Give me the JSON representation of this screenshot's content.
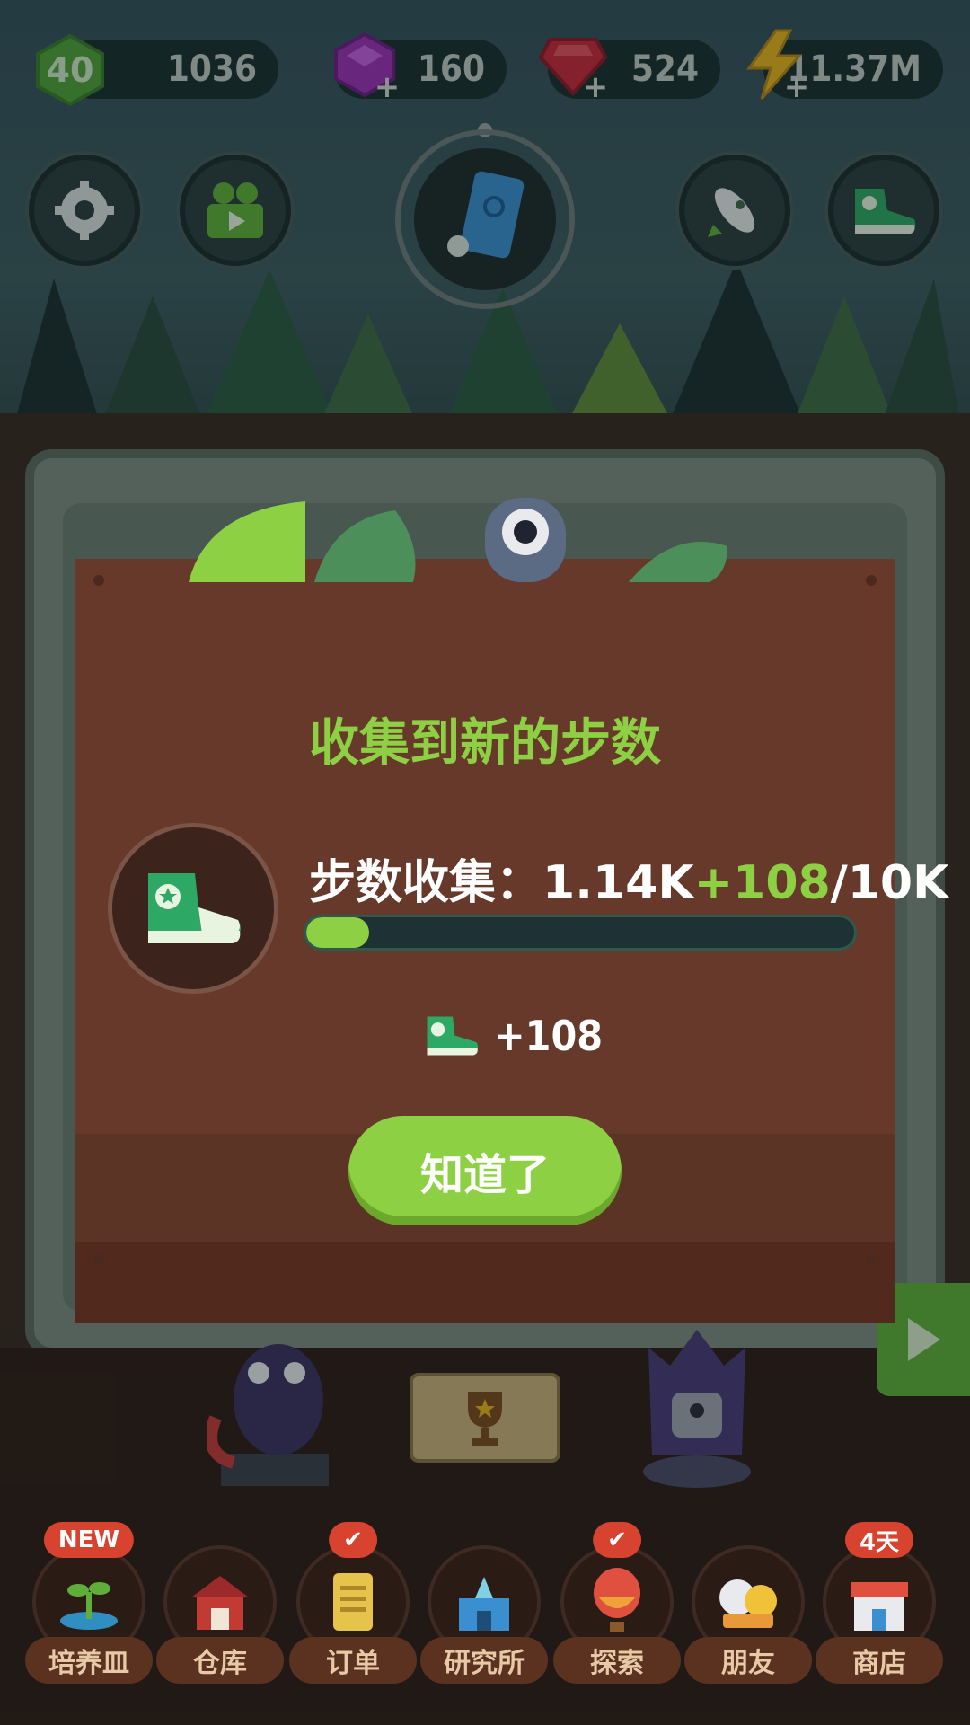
{
  "resources": {
    "level": "40",
    "xp": "1036",
    "gems_purple": "160",
    "gems_red": "524",
    "energy": "11.37M"
  },
  "modal": {
    "title": "收集到新的步数",
    "steps_label": "步数收集：",
    "steps_current": "1.14K",
    "steps_added": "+108",
    "steps_total": "/10K",
    "progress_fraction": 0.114,
    "reward_value": "+108",
    "confirm_label": "知道了"
  },
  "nav": [
    {
      "label": "培养皿",
      "badge": "NEW",
      "icon": "seedling-icon"
    },
    {
      "label": "仓库",
      "badge": "",
      "icon": "barn-icon"
    },
    {
      "label": "订单",
      "badge": "✔",
      "icon": "scroll-icon"
    },
    {
      "label": "研究所",
      "badge": "",
      "icon": "lab-icon"
    },
    {
      "label": "探索",
      "badge": "✔",
      "icon": "balloon-icon"
    },
    {
      "label": "朋友",
      "badge": "",
      "icon": "friends-icon"
    },
    {
      "label": "商店",
      "badge": "4天",
      "icon": "shop-icon"
    }
  ],
  "colors": {
    "accent_green": "#8ed043",
    "modal_brown": "#66392b",
    "badge_red": "#d7432e"
  }
}
